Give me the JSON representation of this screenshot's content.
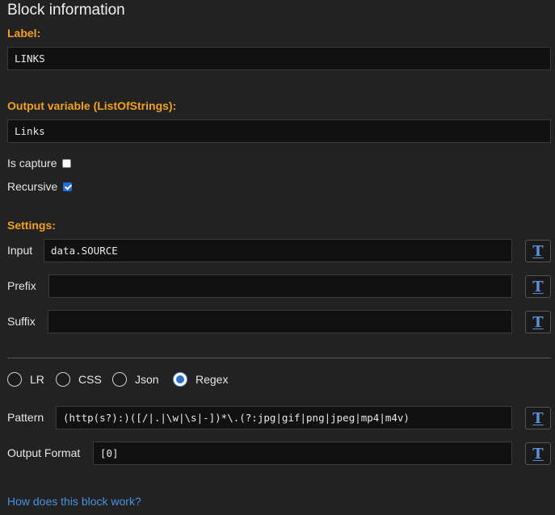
{
  "title": "Block information",
  "label_section": "Label:",
  "label_value": "LINKS",
  "output_section": "Output variable (ListOfStrings):",
  "output_value": "Links",
  "is_capture": {
    "label": "Is capture",
    "checked": false
  },
  "recursive": {
    "label": "Recursive",
    "checked": true
  },
  "settings_section": "Settings:",
  "input": {
    "label": "Input",
    "value": "data.SOURCE"
  },
  "prefix": {
    "label": "Prefix",
    "value": ""
  },
  "suffix": {
    "label": "Suffix",
    "value": ""
  },
  "toggle_button_glyph": "T",
  "modes": [
    {
      "label": "LR",
      "selected": false
    },
    {
      "label": "CSS",
      "selected": false
    },
    {
      "label": "Json",
      "selected": false
    },
    {
      "label": "Regex",
      "selected": true
    }
  ],
  "pattern": {
    "label": "Pattern",
    "value": "(http(s?):)([/|.|\\w|\\s|-])*\\.(?:jpg|gif|png|jpeg|mp4|m4v)"
  },
  "output_format": {
    "label": "Output Format",
    "value": "[0]"
  },
  "help_link": "How does this block work?",
  "colors": {
    "accent": "#f2a11c",
    "link": "#4a90e2",
    "background": "#222222"
  }
}
